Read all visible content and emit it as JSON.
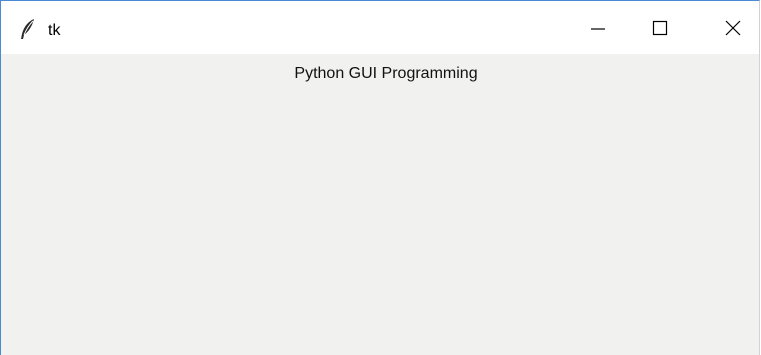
{
  "window": {
    "title": "tk",
    "app_icon": "feather-icon",
    "controls": {
      "minimize_icon": "minimize-icon",
      "maximize_icon": "maximize-icon",
      "close_icon": "close-icon"
    }
  },
  "content": {
    "label": "Python GUI Programming"
  },
  "colors": {
    "window_border": "#4a8ad4",
    "titlebar_bg": "#ffffff",
    "client_bg": "#f1f1f0"
  }
}
